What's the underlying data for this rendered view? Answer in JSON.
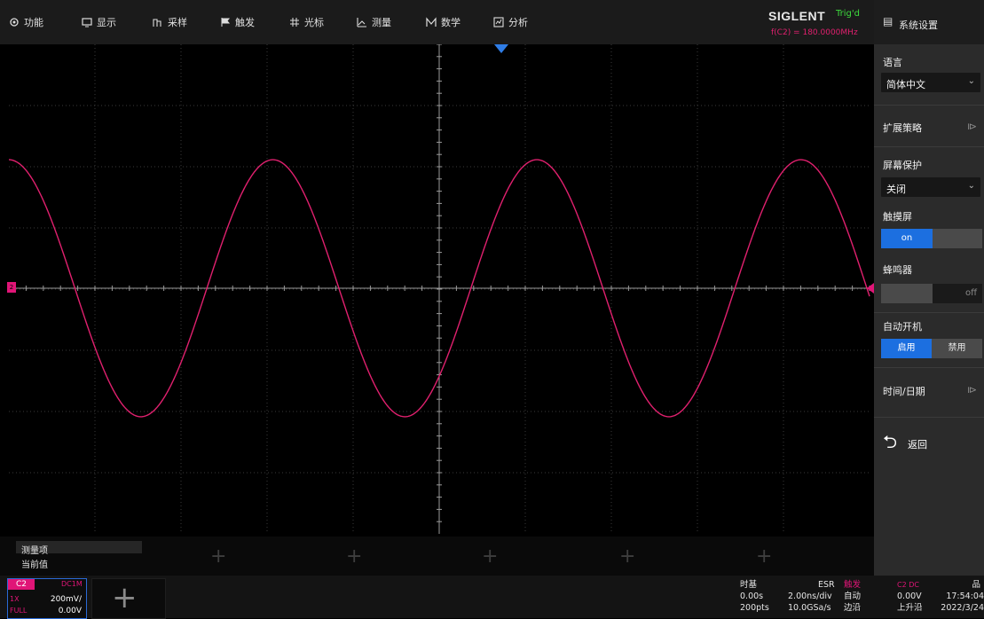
{
  "menu": [
    {
      "label": "功能",
      "icon": "gear-icon"
    },
    {
      "label": "显示",
      "icon": "display-icon"
    },
    {
      "label": "采样",
      "icon": "acquire-icon"
    },
    {
      "label": "触发",
      "icon": "flag-icon"
    },
    {
      "label": "光标",
      "icon": "cursor-icon"
    },
    {
      "label": "测量",
      "icon": "measure-icon"
    },
    {
      "label": "数学",
      "icon": "math-icon"
    },
    {
      "label": "分析",
      "icon": "analysis-icon"
    }
  ],
  "brand": {
    "name": "SIGLENT",
    "trig_state": "Trig'd",
    "freq": "f(C2) = 180.0000MHz"
  },
  "colors": {
    "accent": "#1c6fe0",
    "channel": "#e01577",
    "trace": "#e0206e",
    "trig_ok": "#3ddc3d"
  },
  "waveform": {
    "periods_on_screen": 3.26,
    "phase_at_left": 0.25,
    "amplitude_divs": 2.1
  },
  "measure": {
    "item_label": "测量项",
    "value_label": "当前值"
  },
  "channel": {
    "name": "C2",
    "coupling": "DC1M",
    "scale_key": "1X",
    "scale": "200mV/",
    "offset_key": "FULL",
    "offset": "0.00V"
  },
  "timebase": {
    "title": "时基",
    "mode": "ESR",
    "delay": "0.00s",
    "scale": "2.00ns/div",
    "points": "200pts",
    "rate": "10.0GSa/s"
  },
  "trigger": {
    "title": "触发",
    "source": "C2 DC",
    "mode": "自动",
    "type": "边沿",
    "level": "0.00V",
    "slope": "上升沿"
  },
  "clock": {
    "time": "17:54:04",
    "date": "2022/3/24",
    "icon": "network-icon"
  },
  "sidebar": {
    "title": "系统设置",
    "language_label": "语言",
    "language_value": "简体中文",
    "extend_label": "扩展策略",
    "saver_label": "屏幕保护",
    "saver_value": "关闭",
    "touch_label": "触摸屏",
    "touch_value": "on",
    "beeper_label": "蜂鸣器",
    "beeper_value": "off",
    "autopower_label": "自动开机",
    "autopower_on": "启用",
    "autopower_off": "禁用",
    "datetime_label": "时间/日期",
    "back_label": "返回"
  }
}
